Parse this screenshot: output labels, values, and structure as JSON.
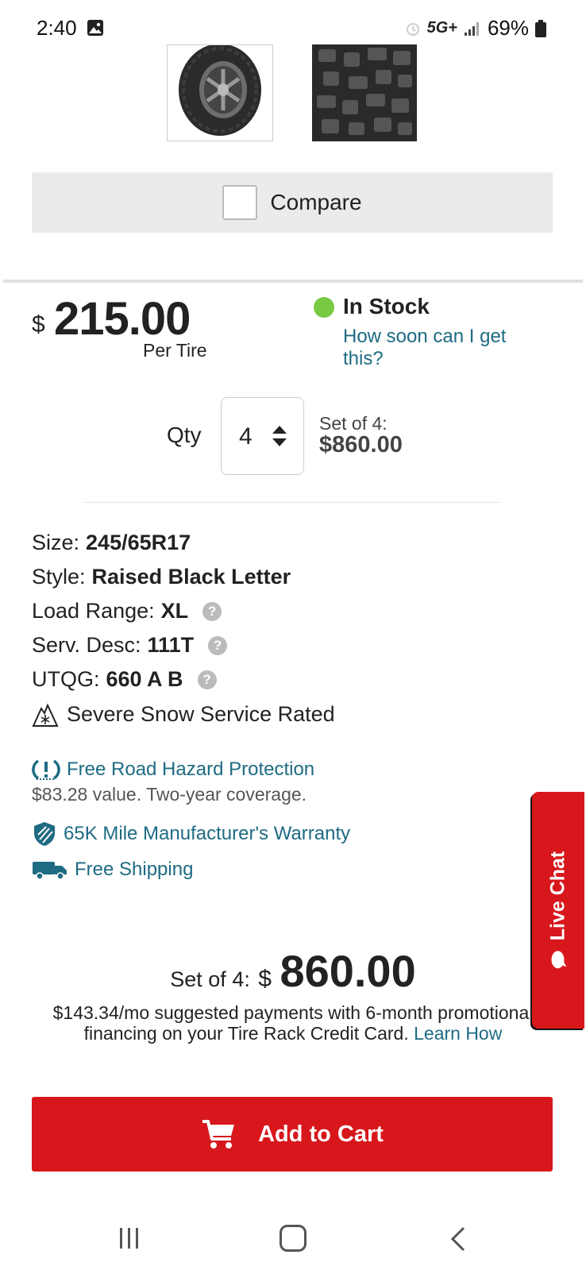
{
  "status_bar": {
    "time": "2:40",
    "network": "5G+",
    "battery": "69%"
  },
  "compare": {
    "label": "Compare",
    "checked": false
  },
  "price": {
    "currency": "$",
    "value": "215.00",
    "unit": "Per Tire"
  },
  "stock": {
    "status": "In Stock",
    "link": "How soon can I get this?",
    "dot_color": "#7ac943"
  },
  "quantity": {
    "label": "Qty",
    "value": "4",
    "set_label": "Set of 4:",
    "set_price": "$860.00"
  },
  "specs": {
    "size_label": "Size:",
    "size_value": "245/65R17",
    "style_label": "Style:",
    "style_value": "Raised Black Letter",
    "load_label": "Load Range:",
    "load_value": "XL",
    "serv_label": "Serv. Desc:",
    "serv_value": "111T",
    "utqg_label": "UTQG:",
    "utqg_value": "660 A B",
    "snow_text": "Severe Snow Service Rated"
  },
  "benefits": {
    "road_hazard": "Free Road Hazard Protection",
    "road_hazard_sub": "$83.28 value. Two-year coverage.",
    "warranty": "65K Mile Manufacturer's Warranty",
    "shipping": "Free Shipping"
  },
  "live_chat": {
    "label": "Live Chat"
  },
  "total": {
    "label": "Set of 4:",
    "currency": "$",
    "value": "860.00"
  },
  "financing": {
    "text": "$143.34/mo suggested payments with 6-month promotional financing on your Tire Rack Credit Card.",
    "link": "Learn How"
  },
  "cart_button": {
    "label": "Add to Cart"
  },
  "colors": {
    "brand_red": "#d7171c",
    "link_teal": "#1e6b83",
    "stock_green": "#7ac943"
  }
}
